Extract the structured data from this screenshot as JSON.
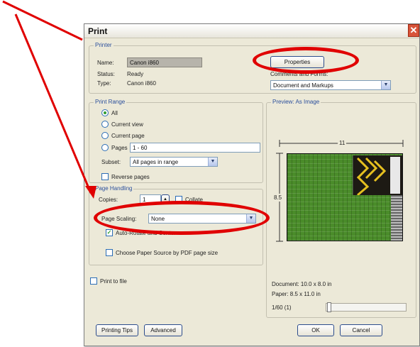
{
  "dialog": {
    "title": "Print"
  },
  "printer": {
    "legend": "Printer",
    "name_label": "Name:",
    "name_value": "Canon i860",
    "status_label": "Status:",
    "status_value": "Ready",
    "type_label": "Type:",
    "type_value": "Canon i860",
    "properties_button": "Properties",
    "comments_label": "Comments and Forms:",
    "comments_value": "Document and Markups"
  },
  "print_range": {
    "legend": "Print Range",
    "options": [
      "All",
      "Current view",
      "Current page",
      "Pages"
    ],
    "selected": "All",
    "pages_value": "1 - 60",
    "subset_label": "Subset:",
    "subset_value": "All pages in range",
    "reverse_label": "Reverse pages"
  },
  "page_handling": {
    "legend": "Page Handling",
    "copies_label": "Copies:",
    "copies_value": "1",
    "collate_label": "Collate",
    "scaling_label": "Page Scaling:",
    "scaling_value": "None",
    "auto_rotate_label": "Auto-Rotate and Center",
    "auto_rotate_checked": true,
    "paper_source_label": "Choose Paper Source by PDF page size",
    "paper_source_checked": false
  },
  "print_to_file": {
    "label": "Print to file",
    "checked": false
  },
  "preview": {
    "legend": "Preview: As Image",
    "width_label": "11",
    "height_label": "8.5",
    "document_size": "Document: 10.0 x 8.0 in",
    "paper_size": "Paper: 8.5 x 11.0 in",
    "page_indicator": "1/60 (1)"
  },
  "buttons": {
    "printing_tips": "Printing Tips",
    "advanced": "Advanced",
    "ok": "OK",
    "cancel": "Cancel"
  },
  "colors": {
    "annotation_red": "#e00000",
    "dialog_bg": "#ece9d8",
    "legend_blue": "#2b4f9c",
    "preview_green": "#4a8c2a"
  }
}
